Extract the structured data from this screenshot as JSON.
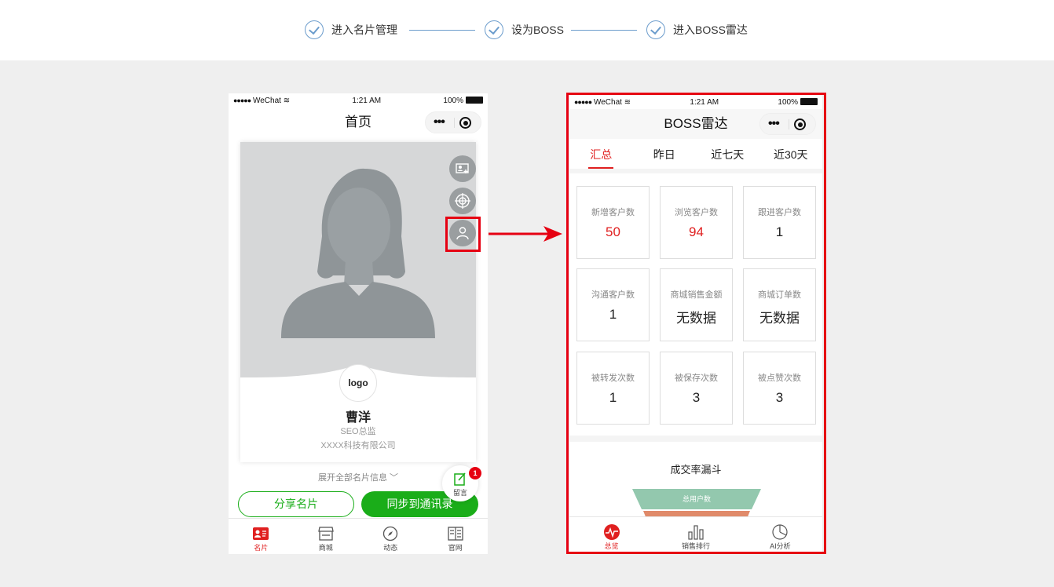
{
  "steps": [
    {
      "label": "进入名片管理"
    },
    {
      "label": "设为BOSS"
    },
    {
      "label": "进入BOSS雷达"
    }
  ],
  "left_phone": {
    "status": {
      "carrier": "WeChat",
      "time": "1:21 AM",
      "battery": "100%"
    },
    "nav_title": "首页",
    "card": {
      "logo": "logo",
      "name": "曹洋",
      "title": "SEO总监",
      "company": "XXXX科技有限公司"
    },
    "expand_label": "展开全部名片信息",
    "share_button": "分享名片",
    "sync_button": "同步到通讯录",
    "message": {
      "label": "留言",
      "badge": "1"
    },
    "tabs": [
      {
        "label": "名片",
        "icon": "card-icon"
      },
      {
        "label": "商城",
        "icon": "shop-icon"
      },
      {
        "label": "动态",
        "icon": "compass-icon"
      },
      {
        "label": "官网",
        "icon": "website-icon"
      }
    ]
  },
  "right_phone": {
    "status": {
      "carrier": "WeChat",
      "time": "1:21 AM",
      "battery": "100%"
    },
    "nav_title": "BOSS雷达",
    "tabs": [
      "汇总",
      "昨日",
      "近七天",
      "近30天"
    ],
    "stats": [
      {
        "label": "新增客户数",
        "value": "50",
        "highlight": true
      },
      {
        "label": "浏览客户数",
        "value": "94",
        "highlight": true
      },
      {
        "label": "跟进客户数",
        "value": "1",
        "highlight": false
      },
      {
        "label": "沟通客户数",
        "value": "1",
        "highlight": false
      },
      {
        "label": "商城销售金额",
        "value": "无数据",
        "highlight": false
      },
      {
        "label": "商城订单数",
        "value": "无数据",
        "highlight": false
      },
      {
        "label": "被转发次数",
        "value": "1",
        "highlight": false
      },
      {
        "label": "被保存次数",
        "value": "3",
        "highlight": false
      },
      {
        "label": "被点赞次数",
        "value": "3",
        "highlight": false
      }
    ],
    "funnel_title": "成交率漏斗",
    "funnel_top_label": "总用户数",
    "bottom_tabs": [
      {
        "label": "总览",
        "icon": "pulse-icon"
      },
      {
        "label": "销售排行",
        "icon": "bar-chart-icon"
      },
      {
        "label": "AI分析",
        "icon": "pie-chart-icon"
      }
    ]
  },
  "colors": {
    "accent_red": "#e02020",
    "wechat_green": "#1aad19",
    "step_blue": "#6b9ccc",
    "highlight_frame": "#e60012"
  }
}
